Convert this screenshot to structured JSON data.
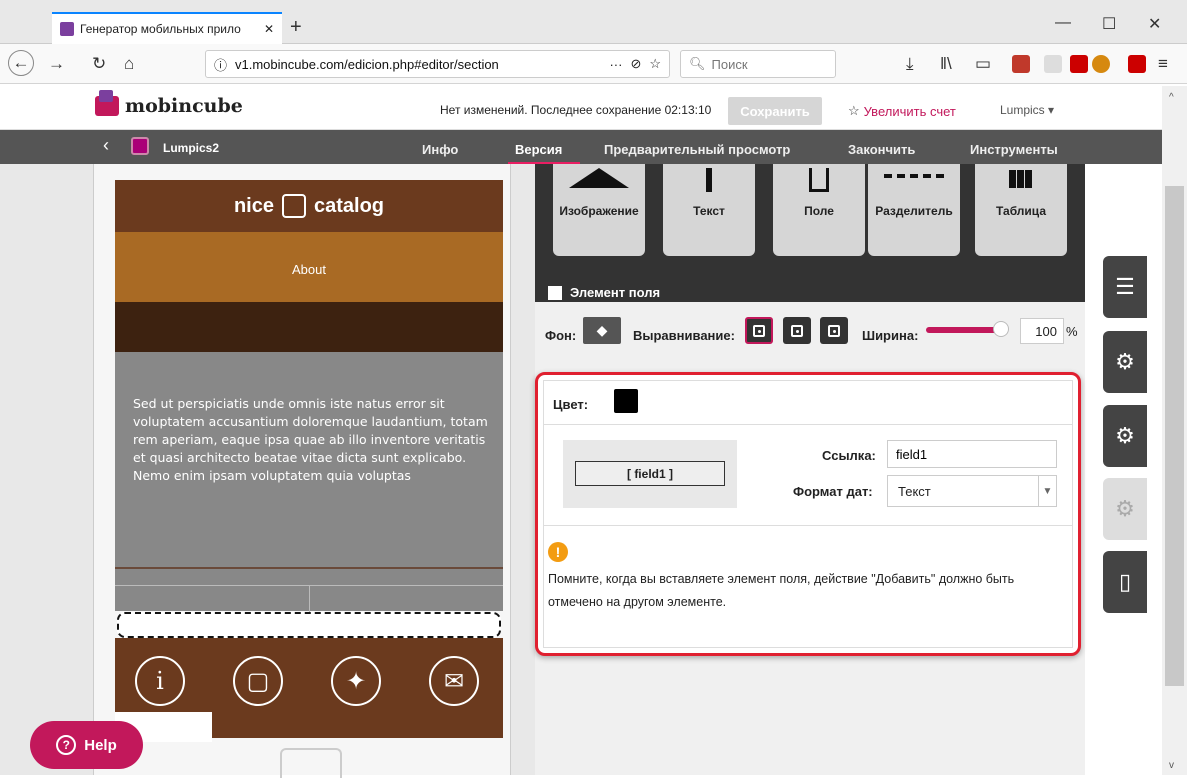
{
  "browser": {
    "tab_title": "Генератор мобильных прило",
    "url": "v1.mobincube.com/edicion.php#editor/section",
    "search_placeholder": "Поиск"
  },
  "app": {
    "brand": "mobincube",
    "status": "Нет изменений. Последнее сохранение 02:13:10",
    "save_label": "Сохранить",
    "upgrade_label": "Увеличить счет",
    "user": "Lumpics"
  },
  "mainnav": {
    "project": "Lumpics2",
    "items": [
      "Инфо",
      "Версия",
      "Предварительный просмотр",
      "Закончить",
      "Инструменты"
    ]
  },
  "phone": {
    "title_left": "nice",
    "title_right": "catalog",
    "about": "About",
    "body_text": "Sed ut perspiciatis unde omnis iste natus error sit voluptatem accusantium doloremque laudantium, totam rem aperiam, eaque ipsa quae ab illo inventore veritatis et quasi architecto beatae vitae dicta sunt explicabo. Nemo enim ipsam voluptatem quia voluptas"
  },
  "help_label": "Help",
  "palette": [
    "Изображение",
    "Текст",
    "Поле",
    "Разделитель",
    "Таблица"
  ],
  "element_title": "Элемент поля",
  "props": {
    "bg_label": "Фон:",
    "align_label": "Выравнивание:",
    "width_label": "Ширина:",
    "width_value": "100",
    "width_unit": "%",
    "width_fraction": 1.0
  },
  "card": {
    "color_label": "Цвет:",
    "field_preview": "[ field1 ]",
    "link_label": "Ссылка:",
    "link_value": "field1",
    "format_label": "Формат дат:",
    "format_value": "Текст",
    "warning": "Помните, когда вы вставляете элемент поля, действие \"Добавить\" должно быть отмечено на другом элементе."
  },
  "colors": {
    "accent": "#c2185b",
    "brown": "#6b3a1e",
    "highlight": "#e02030"
  }
}
